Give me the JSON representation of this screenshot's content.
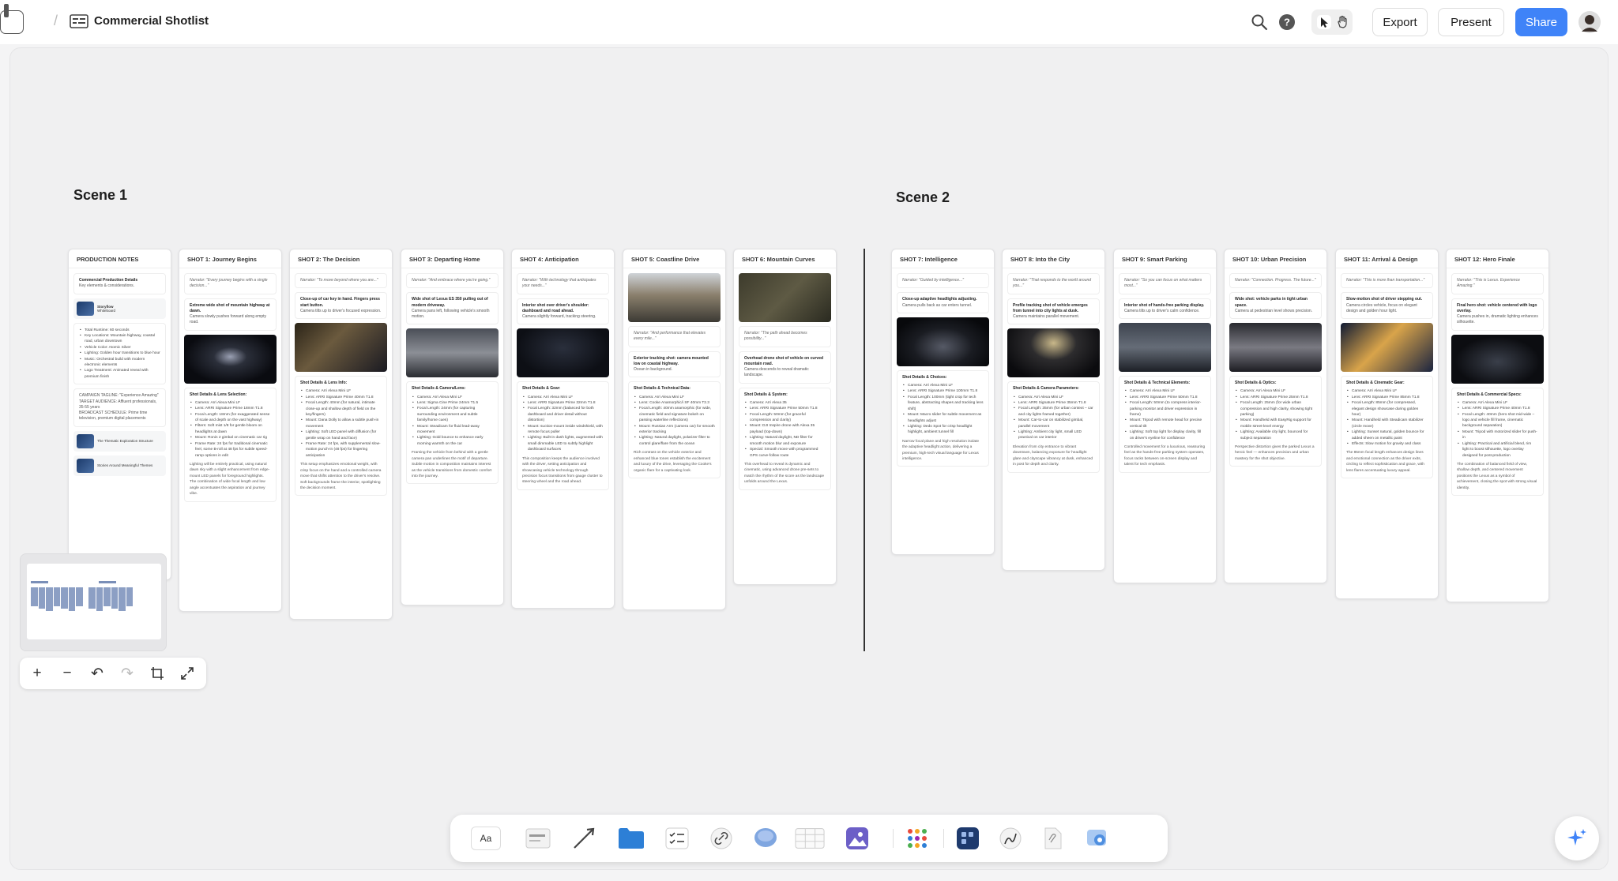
{
  "header": {
    "title": "Commercial Shotlist",
    "export_label": "Export",
    "present_label": "Present",
    "share_label": "Share"
  },
  "scenes": {
    "scene1": "Scene 1",
    "scene2": "Scene 2"
  },
  "production_notes": {
    "title": "PRODUCTION NOTES",
    "subtitle": "Commercial Production Details",
    "subtitle_note": "Key elements & considerations.",
    "attach1_title": "Storyflow",
    "attach1_sub": "Whiteboard",
    "items": [
      "Total Runtime: 60 seconds",
      "Key Locations: Mountain highway, coastal road, urban downtown",
      "Vehicle Color: Atomic Silver",
      "Lighting: Golden hour transitions to blue hour",
      "Music: Orchestral build with modern electronic elements",
      "Logo Treatment: Animated reveal with premium finish"
    ],
    "campaign": "CAMPAIGN TAGLINE: \"Experience Amazing\"",
    "audience": "TARGET AUDIENCE: Affluent professionals, 35-55 years",
    "schedule": "BROADCAST SCHEDULE: Prime time television, premium digital placements",
    "attach2": "The Thematic Exploration Structure",
    "attach3": "Stories Around Meaningful Themes"
  },
  "shots": [
    {
      "title": "SHOT 1: Journey Begins",
      "narrator": "Narrator: \"Every journey begins with a single decision...\"",
      "desc_bold": "Extreme wide shot of mountain highway at dawn.",
      "desc": "Camera slowly pushes forward along empty road.",
      "detail_title": "Shot Details & Lens Selection:",
      "details": [
        "Camera: Arri Alexa Mini LF",
        "Lens: ARRI Signature Prime 18mm T1.8",
        "Focal Length: 18mm (for exaggerated sense of scale and depth on the vast highway)",
        "Filters: Soft mist 1/8 for gentle bloom on headlights at dawn",
        "Mount: Ronin 2 gimbal on cinematic car rig",
        "Frame Rate: 24 fps for traditional cinematic feel, some B-roll at 48 fps for subtle speed-ramp options in edit"
      ],
      "para": "Lighting will be entirely practical, using natural dawn sky with a slight enhancement from edge-mount LED panels for foreground highlights. The combination of wide focal length and low angle accentuates the aspiration and journey vibe."
    },
    {
      "title": "SHOT 2: The Decision",
      "narrator": "Narrator: \"To move beyond where you are...\"",
      "desc_bold": "Close-up of car key in hand. Fingers press start button.",
      "desc": "Camera tilts up to driver's focused expression.",
      "detail_title": "Shot Details & Lens Info:",
      "details": [
        "Camera: Arri Alexa Mini LF",
        "Lens: ARRI Signature Prime 40mm T1.8",
        "Focal Length: 40mm (for natural, intimate close-up and shallow depth of field on the key/fingers)",
        "Mount: Dana Dolly to allow a subtle push-in movement",
        "Lighting: Soft LED panel with diffusion (for gentle wrap on hand and face)",
        "Frame Rate: 24 fps, with supplemental slow-motion punch-in (48 fps) for lingering anticipation"
      ],
      "para": "This setup emphasizes emotional weight, with crisp focus on the hand and a controlled camera move that shifts attention to the driver's resolve. Soft backgrounds frame the interior, spotlighting the decision moment."
    },
    {
      "title": "SHOT 3: Departing Home",
      "narrator": "Narrator: \"And embrace where you're going.\"",
      "desc_bold": "Wide shot of Lexus ES 350 pulling out of modern driveway.",
      "desc": "Camera pans left, following vehicle's smooth motion.",
      "detail_title": "Shot Details & Camera/Lens:",
      "details": [
        "Camera: Arri Alexa Mini LF",
        "Lens: Sigma Cine Prime 24mm T1.5",
        "Focal Length: 24mm (for capturing surrounding environment and subtle family/home cues)",
        "Mount: Steadicam for fluid lead-away movement",
        "Lighting: Gold bounce to enhance early morning warmth on the car"
      ],
      "para": "Framing the vehicle from behind with a gentle camera pan underlines the motif of departure. Subtle motion in composition maintains interest as the vehicle transitions from domestic comfort into the journey."
    },
    {
      "title": "SHOT 4: Anticipation",
      "narrator": "Narrator: \"With technology that anticipates your needs...\"",
      "desc_bold": "Interior shot over driver's shoulder: dashboard and road ahead.",
      "desc": "Camera slightly forward, tracking steering.",
      "detail_title": "Shot Details & Gear:",
      "details": [
        "Camera: Arri Alexa Mini LF",
        "Lens: ARRI Signature Prime 32mm T1.8",
        "Focal Length: 32mm (balanced for both dashboard and driver detail without distortion)",
        "Mount: suction-mount inside windshield, with remote focus puller",
        "Lighting: Built-in dash lights, augmented with small dimmable LED to subtly highlight dashboard surfaces"
      ],
      "para": "This composition keeps the audience involved with the driver, setting anticipation and showcasing vehicle technology through precision focus transitions from gauge cluster to steering wheel and the road ahead."
    },
    {
      "title": "SHOT 5: Coastline Drive",
      "narrator": "Narrator: \"And performance that elevates every mile...\"",
      "desc_bold": "Exterior tracking shot: camera mounted low on coastal highway.",
      "desc": "Ocean in background.",
      "detail_title": "Shot Details & Technical Data:",
      "details": [
        "Camera: Arri Alexa Mini LF",
        "Lens: Cooke Anamorphic/i SF 40mm T2.3",
        "Focal Length: 40mm anamorphic (for wide, cinematic field and signature bokeh on passing waterline reflections)",
        "Mount: Russian Arm (camera car) for smooth exterior tracking",
        "Lighting: Natural daylight, polarizer filter to control glare/flare from the ocean"
      ],
      "para": "Rich contrast on the vehicle exterior and enhanced blue tones establish the excitement and luxury of the drive, leveraging the Cooke's organic flare for a captivating look."
    },
    {
      "title": "SHOT 6: Mountain Curves",
      "narrator": "Narrator: \"The path ahead becomes possibility...\"",
      "desc_bold": "Overhead drone shot of vehicle on curved mountain road.",
      "desc": "Camera descends to reveal dramatic landscape.",
      "detail_title": "Shot Details & System:",
      "details": [
        "Camera: Arri Alexa 35",
        "Lens: ARRI Signature Prime 50mm T1.8",
        "Focal Length: 50mm (for graceful compression and clarity)",
        "Mount: DJI Inspire drone with Alexa 35 payload (top-down)",
        "Lighting: Natural daylight, ND filter for smooth motion blur and exposure",
        "Special: Smooth move with programmed GPS curve-follow route"
      ],
      "para": "This overhead to reveal is dynamic and cinematic, using advanced drone pre-sets to match the rhythm of the score as the landscape unfolds around the Lexus."
    },
    {
      "title": "SHOT 7: Intelligence",
      "narrator": "Narrator: \"Guided by intelligence...\"",
      "desc_bold": "Close-up adaptive headlights adjusting.",
      "desc": "Camera pulls back as car enters tunnel.",
      "detail_title": "Shot Details & Choices:",
      "details": [
        "Camera: Arri Alexa Mini LF",
        "Lens: ARRI Signature Prime 100mm T1.8",
        "Focal Length: 100mm (tight crop for tech feature, abstracting shapes and tracking lens shift)",
        "Mount: Macro slider for subtle movement as headlights adjust",
        "Lighting: Dedo Spot for crisp headlight highlight, ambient tunnel fill"
      ],
      "para": "Narrow focal plane and high resolution isolate the adaptive headlight action, delivering a premium, high-tech visual language for Lexus intelligence."
    },
    {
      "title": "SHOT 8: Into the City",
      "narrator": "Narrator: \"That responds to the world around you...\"",
      "desc_bold": "Profile tracking shot of vehicle emerges from tunnel into city lights at dusk.",
      "desc": "Camera maintains parallel movement.",
      "detail_title": "Shot Details & Camera Parameters:",
      "details": [
        "Camera: Arri Alexa Mini LF",
        "Lens: ARRI Signature Prime 35mm T1.8",
        "Focal Length: 35mm (for urban context – car and city lights framed together)",
        "Mount: Car-to-car on stabilized gimbal, parallel movement",
        "Lighting: Ambient city light, small LED practical on car interior"
      ],
      "para": "Elevation from city entrance to vibrant downtown, balancing exposure for headlight glare and cityscape vibrancy at dusk, enhanced in post for depth and clarity."
    },
    {
      "title": "SHOT 9: Smart Parking",
      "narrator": "Narrator: \"So you can focus on what matters most...\"",
      "desc_bold": "Interior shot of hands-free parking display.",
      "desc": "Camera tilts up to driver's calm confidence.",
      "detail_title": "Shot Details & Technical Elements:",
      "details": [
        "Camera: Arri Alexa Mini LF",
        "Lens: ARRI Signature Prime 50mm T1.8",
        "Focal Length: 50mm (to compress interior-parking monitor and driver expression in frame)",
        "Mount: Tripod with remote head for precise vertical tilt",
        "Lighting: Soft top light for display clarity, fill on driver's eyeline for confidence"
      ],
      "para": "Controlled movement for a luxurious, reassuring feel as the hands-free parking system operates, focus racks between on-screen display and talent for tech emphasis."
    },
    {
      "title": "SHOT 10: Urban Precision",
      "narrator": "Narrator: \"Connection. Progress. The future...\"",
      "desc_bold": "Wide shot: vehicle parks in tight urban space.",
      "desc": "Camera at pedestrian level shows precision.",
      "detail_title": "Shot Details & Optics:",
      "details": [
        "Camera: Arri Alexa Mini LF",
        "Lens: ARRI Signature Prime 25mm T1.8",
        "Focal Length: 25mm (for wide urban compression and high clarity, showing tight parking)",
        "Mount: Handheld with EasyRig support for mobile street-level energy",
        "Lighting: Available city light, bounced for subject separation"
      ],
      "para": "Perspective distortion gives the parked Lexus a heroic feel — enhances precision and urban mastery for the shot objective."
    },
    {
      "title": "SHOT 11: Arrival & Design",
      "narrator": "Narrator: \"This is more than transportation...\"",
      "desc_bold": "Slow-motion shot of driver stepping out.",
      "desc": "Camera circles vehicle, focus on elegant design and golden hour light.",
      "detail_title": "Shot Details & Cinematic Gear:",
      "details": [
        "Camera: Arri Alexa Mini LF",
        "Lens: ARRI Signature Prime 85mm T1.8",
        "Focal Length: 85mm (for compressed, elegant design showcase during golden hour)",
        "Mount: Handheld with Steadicam stabilizer (circle move)",
        "Lighting: Sunset natural, golden bounce for added sheen on metallic paint",
        "Effects: Slow motion for gravity and class"
      ],
      "para": "The 85mm focal length enhances design lines and emotional connection as the driver exits, circling to reflect sophistication and grace, with lens flares accentuating luxury appeal."
    },
    {
      "title": "SHOT 12: Hero Finale",
      "narrator": "Narrator: \"This is Lexus. Experience Amazing.\"",
      "desc_bold": "Final hero shot: vehicle centered with logo overlay.",
      "desc": "Camera pushes in, dramatic lighting enhances silhouette.",
      "detail_title": "Shot Details & Commercial Specs:",
      "details": [
        "Camera: Arri Alexa Mini LF",
        "Lens: ARRI Signature Prime 40mm T1.8",
        "Focal Length: 40mm (hero shot mid-wide – logo and vehicle fill frame, cinematic background separation)",
        "Mount: Tripod with motorized slider for push-in",
        "Lighting: Practical and artificial blend, rim light to boost silhouette, logo overlay designed for post-production"
      ],
      "para": "The combination of balanced field of view, shallow depth, and centered movement positions the Lexus as a symbol of achievement, closing the spot with strong visual identity."
    }
  ],
  "colors": {
    "accent": "#3f83f8",
    "canvas": "#f0f0f1"
  }
}
